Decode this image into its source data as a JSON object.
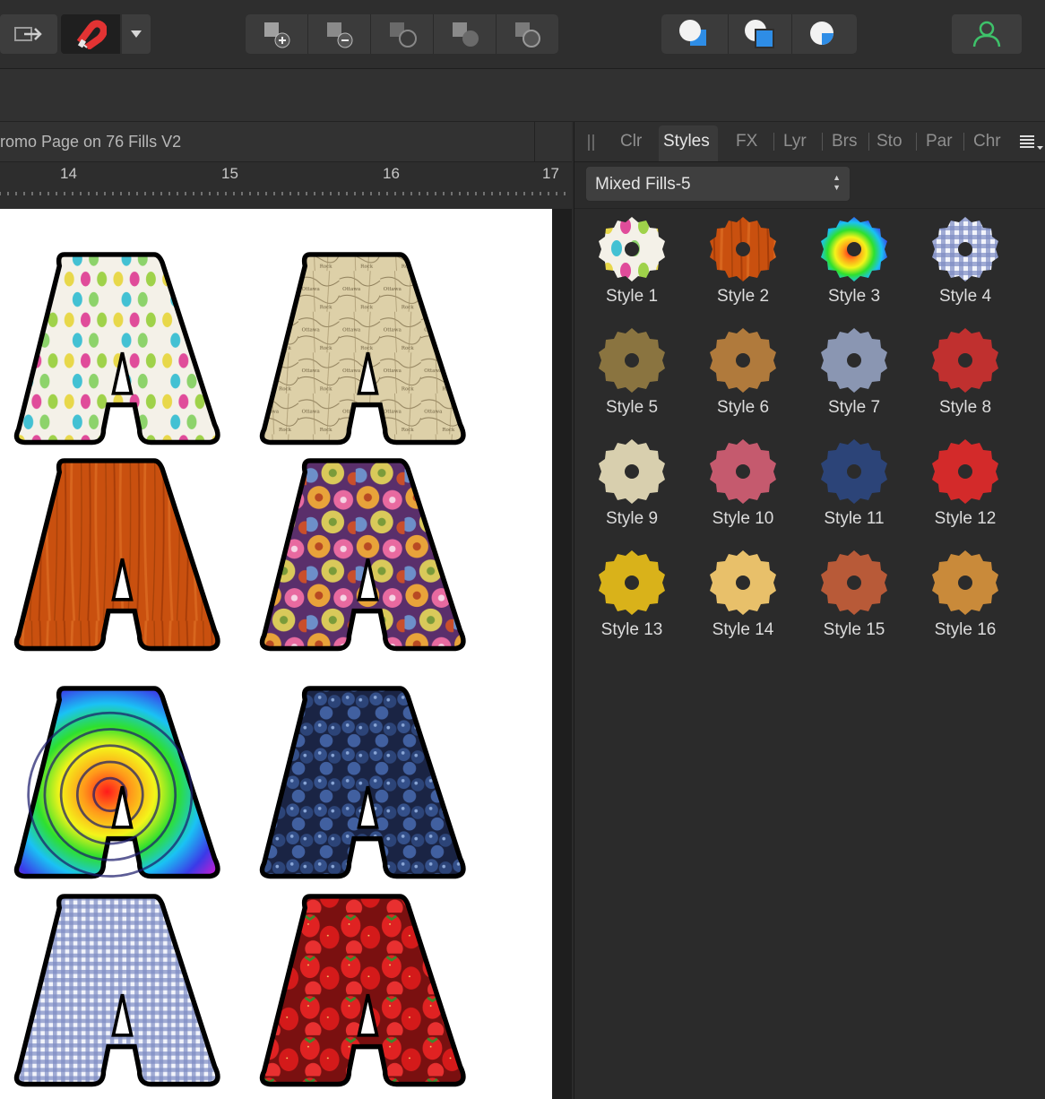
{
  "toolbar": {
    "move_tool_icon": "move-tool-icon",
    "snapping_icon": "magnet-icon",
    "snapping_dropdown_icon": "chevron-down-icon",
    "arrange_group": [
      "insert-above-icon",
      "insert-below-icon",
      "insert-behind-icon",
      "insert-front-icon",
      "insert-inside-icon"
    ],
    "boolean_group": [
      "add-icon",
      "subtract-icon",
      "intersect-icon"
    ],
    "persona_icon": "user-icon"
  },
  "document": {
    "title": "romo Page on 76 Fills V2"
  },
  "ruler": {
    "labels": [
      "14",
      "15",
      "16",
      "17"
    ]
  },
  "canvas": {
    "letter": "A",
    "fills": [
      "easter eggs",
      "antique map",
      "wood",
      "chrysanthemums",
      "rainbow rings",
      "blueberries",
      "gingham",
      "strawberries"
    ]
  },
  "panel": {
    "tabs": [
      "Clr",
      "Styles",
      "FX",
      "Lyr",
      "Brs",
      "Sto",
      "Par",
      "Chr"
    ],
    "active_tab": "Styles",
    "menu_icon": "hamburger-menu-icon",
    "category": "Mixed Fills-5",
    "styles": [
      {
        "label": "Style 1"
      },
      {
        "label": "Style 2"
      },
      {
        "label": "Style 3"
      },
      {
        "label": "Style 4"
      },
      {
        "label": "Style 5"
      },
      {
        "label": "Style 6"
      },
      {
        "label": "Style 7"
      },
      {
        "label": "Style 8"
      },
      {
        "label": "Style 9"
      },
      {
        "label": "Style 10"
      },
      {
        "label": "Style 11"
      },
      {
        "label": "Style 12"
      },
      {
        "label": "Style 13"
      },
      {
        "label": "Style 14"
      },
      {
        "label": "Style 15"
      },
      {
        "label": "Style 16"
      }
    ]
  }
}
